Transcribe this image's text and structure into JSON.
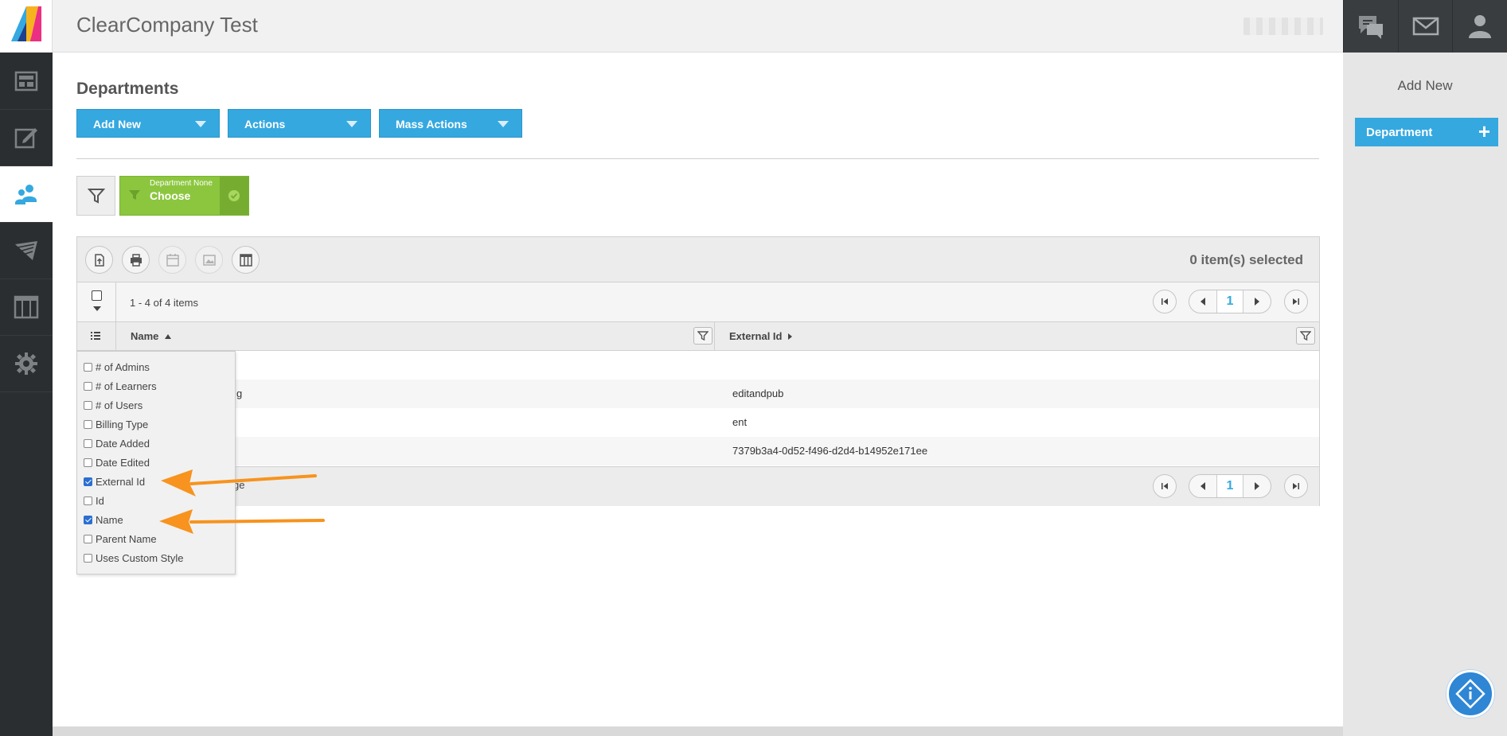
{
  "app": {
    "title": "ClearCompany Test"
  },
  "nav": {
    "items": [
      {
        "name": "dashboard",
        "icon": "dashboard-icon"
      },
      {
        "name": "edit",
        "icon": "edit-icon"
      },
      {
        "name": "users",
        "icon": "users-icon",
        "active": true
      },
      {
        "name": "courses",
        "icon": "paper-plane-icon"
      },
      {
        "name": "reports",
        "icon": "columns-icon"
      },
      {
        "name": "settings",
        "icon": "gear-icon"
      }
    ]
  },
  "topbar": {
    "icons": [
      "chat-icon",
      "mail-icon",
      "user-icon"
    ]
  },
  "right_panel": {
    "title": "Add New",
    "button_label": "Department",
    "button_symbol": "+"
  },
  "page": {
    "title": "Departments",
    "buttons": {
      "add_new": "Add New",
      "actions": "Actions",
      "mass_actions": "Mass Actions"
    },
    "filter_chip": {
      "label": "Department None",
      "value": "Choose"
    }
  },
  "grid": {
    "selected_text": "0 item(s) selected",
    "items_info": "1 - 4 of 4 items",
    "page_number": "1",
    "columns": {
      "name": "Name",
      "external_id": "External Id"
    },
    "rows": [
      {
        "name": "",
        "external_id": ""
      },
      {
        "name": "g",
        "external_id": "editandpub"
      },
      {
        "name": "",
        "external_id": "ent"
      },
      {
        "name": "",
        "external_id": "7379b3a4-0d52-f496-d2d4-b14952e171ee"
      }
    ],
    "footer_text": "ge"
  },
  "column_menu": {
    "items": [
      {
        "label": "# of Admins",
        "checked": false
      },
      {
        "label": "# of Learners",
        "checked": false
      },
      {
        "label": "# of Users",
        "checked": false
      },
      {
        "label": "Billing Type",
        "checked": false
      },
      {
        "label": "Date Added",
        "checked": false
      },
      {
        "label": "Date Edited",
        "checked": false
      },
      {
        "label": "External Id",
        "checked": true
      },
      {
        "label": "Id",
        "checked": false
      },
      {
        "label": "Name",
        "checked": true
      },
      {
        "label": "Parent Name",
        "checked": false
      },
      {
        "label": "Uses Custom Style",
        "checked": false
      }
    ]
  },
  "colors": {
    "primary": "#35a8e0",
    "chip_green": "#8cc63f",
    "annotation_orange": "#f7931e",
    "nav_dark": "#2b2e30"
  }
}
